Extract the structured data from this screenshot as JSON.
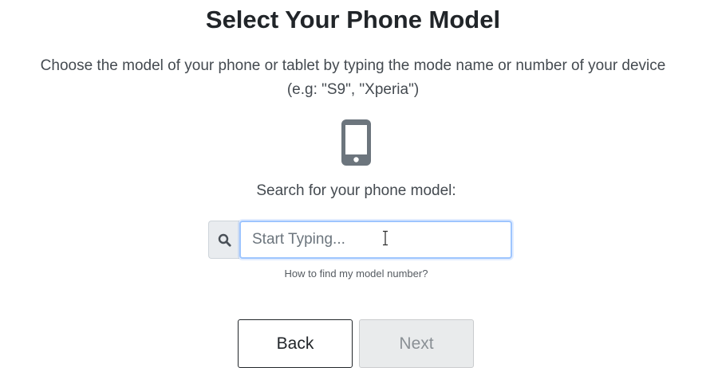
{
  "header": {
    "title": "Select Your Phone Model",
    "description_line1": "Choose the model of your phone or tablet by typing the mode name or number of your device",
    "description_line2": "(e.g: \"S9\", \"Xperia\")"
  },
  "device_icon": "mobile-phone-icon",
  "search": {
    "label": "Search for your phone model:",
    "placeholder": "Start Typing...",
    "value": "",
    "addon_icon": "search-icon",
    "help_link": "How to find my model number?"
  },
  "buttons": {
    "back_label": "Back",
    "next_label": "Next",
    "next_disabled": true
  },
  "colors": {
    "text": "#212529",
    "icon": "#6c757d",
    "input_focus_border": "#9ec5fe",
    "disabled_button_bg": "#e9ebec"
  }
}
